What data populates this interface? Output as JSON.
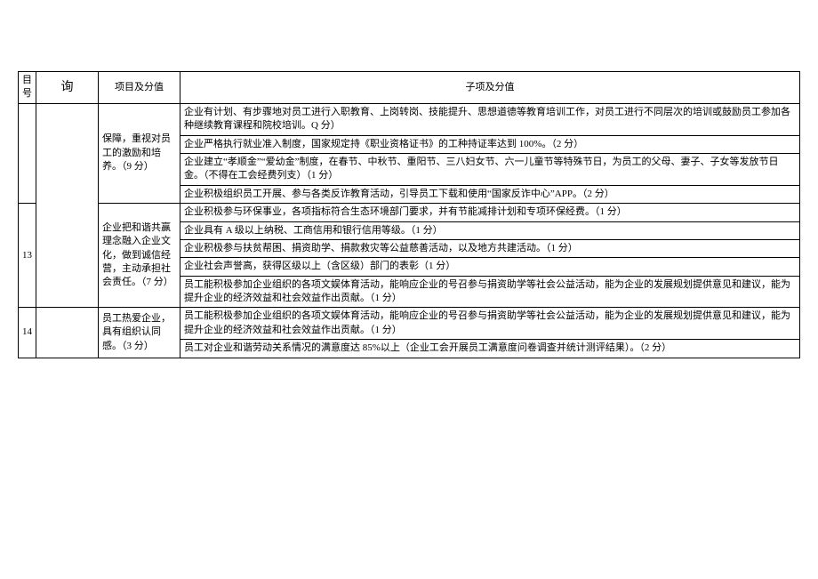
{
  "header": {
    "num": "目号",
    "query": "询",
    "project": "项目及分值",
    "sub": "子项及分值"
  },
  "row_first": {
    "project": "保障，重视对员工的激励和培养。（9 分）",
    "subs": [
      "企业有计划、有步骤地对员工进行入职教育、上岗转岗、技能提升、思想道德等教育培训工作，对员工进行不同层次的培训或鼓励员工参加各种继续教育课程和院校培训。Q 分）",
      "企业严格执行就业准入制度，国家规定持《职业资格证书》的工种持证率达到 100%。（2 分）",
      "企业建立“孝顺金”“爱幼金”制度，在春节、中秋节、重阳节、三八妇女节、六一儿童节等特殊节日，为员工的父母、妻子、子女等发放节日金。（不得在工会经费列支）（1 分）",
      "企业积极组织员工开展、参与各类反诈教育活动，引导员工下载和使用“国家反诈中心”APP。（2 分）"
    ]
  },
  "row_13": {
    "num": "13",
    "project": "企业把和谐共赢理念融入企业文化，做到诚信经营，主动承担社会责任。（7 分）",
    "subs": [
      "企业积极参与环保事业，各项指标符合生态环境部门要求，并有节能减排计划和专项环保经费。（1 分）",
      "企业具有 A 级以上纳税、工商信用和银行信用等级。（1 分）",
      "企业积极参与扶贫帮困、捐资助学、捐款救灾等公益慈善活动，以及地方共建活动。（1 分）",
      "企业社会声誉高，获得区级以上（含区级）部门的表彰（1 分）",
      "员工能积极参加企业组织的各项文娱体育活动，能响应企业的号召参与捐资助学等社会公益活动，能为企业的发展规划提供意见和建议，能为提升企业的经济效益和社会效益作出贡献。（1 分）"
    ]
  },
  "row_14": {
    "num": "14",
    "project": "员工热爱企业，具有组织认同感。（3 分）",
    "subs": [
      "员工能积极参加企业组织的各项文娱体育活动，能响应企业的号召参与捐资助学等社会公益活动，能为企业的发展规划提供意见和建议，能为提升企业的经济效益和社会效益作出贡献。（1 分）",
      "员工对企业和谐劳动关系情况的满意度达 85%以上（企业工会开展员工满意度问卷调查并统计测评结果）。（2 分）"
    ]
  }
}
